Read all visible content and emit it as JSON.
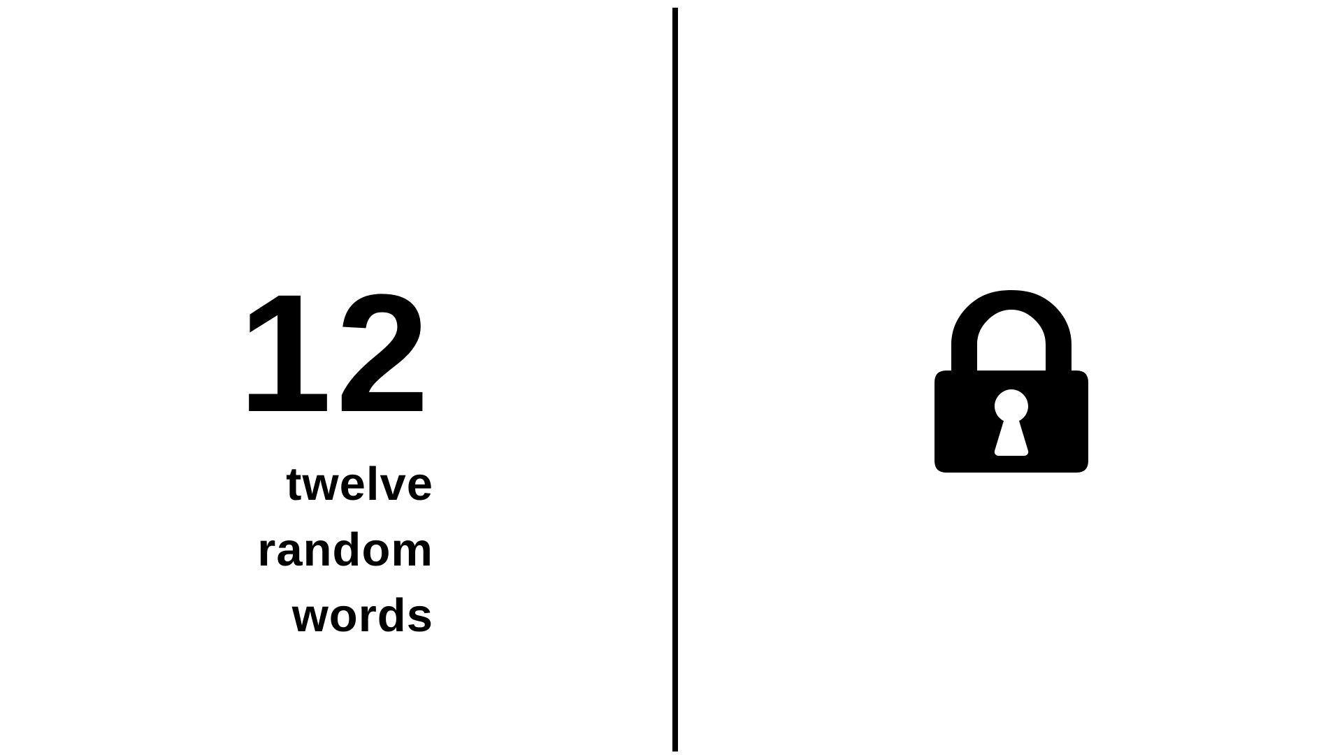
{
  "slide": {
    "number": "12",
    "caption": {
      "line1": "twelve",
      "line2": "random",
      "line3": "words"
    },
    "icon": "padlock-icon",
    "colors": {
      "background": "#ffffff",
      "foreground": "#000000"
    }
  }
}
